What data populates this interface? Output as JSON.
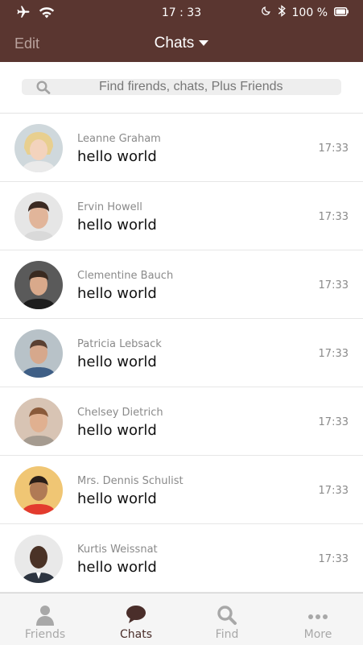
{
  "status_bar": {
    "time": "17 : 33",
    "battery": "100 %"
  },
  "nav": {
    "edit": "Edit",
    "title": "Chats"
  },
  "search": {
    "placeholder": "Find firends, chats, Plus Friends"
  },
  "chats": [
    {
      "name": "Leanne Graham",
      "message": "hello world",
      "time": "17:33"
    },
    {
      "name": "Ervin Howell",
      "message": "hello world",
      "time": "17:33"
    },
    {
      "name": "Clementine Bauch",
      "message": "hello world",
      "time": "17:33"
    },
    {
      "name": "Patricia Lebsack",
      "message": "hello world",
      "time": "17:33"
    },
    {
      "name": "Chelsey Dietrich",
      "message": "hello world",
      "time": "17:33"
    },
    {
      "name": "Mrs. Dennis Schulist",
      "message": "hello world",
      "time": "17:33"
    },
    {
      "name": "Kurtis Weissnat",
      "message": "hello world",
      "time": "17:33"
    }
  ],
  "tabs": [
    {
      "label": "Friends",
      "icon": "person-icon",
      "active": false
    },
    {
      "label": "Chats",
      "icon": "chat-bubble-icon",
      "active": true
    },
    {
      "label": "Find",
      "icon": "search-icon",
      "active": false
    },
    {
      "label": "More",
      "icon": "more-dots-icon",
      "active": false
    }
  ],
  "colors": {
    "brand": "#5a3630",
    "tab_active": "#4a2e2a",
    "tab_inactive": "#a8a8a8"
  }
}
